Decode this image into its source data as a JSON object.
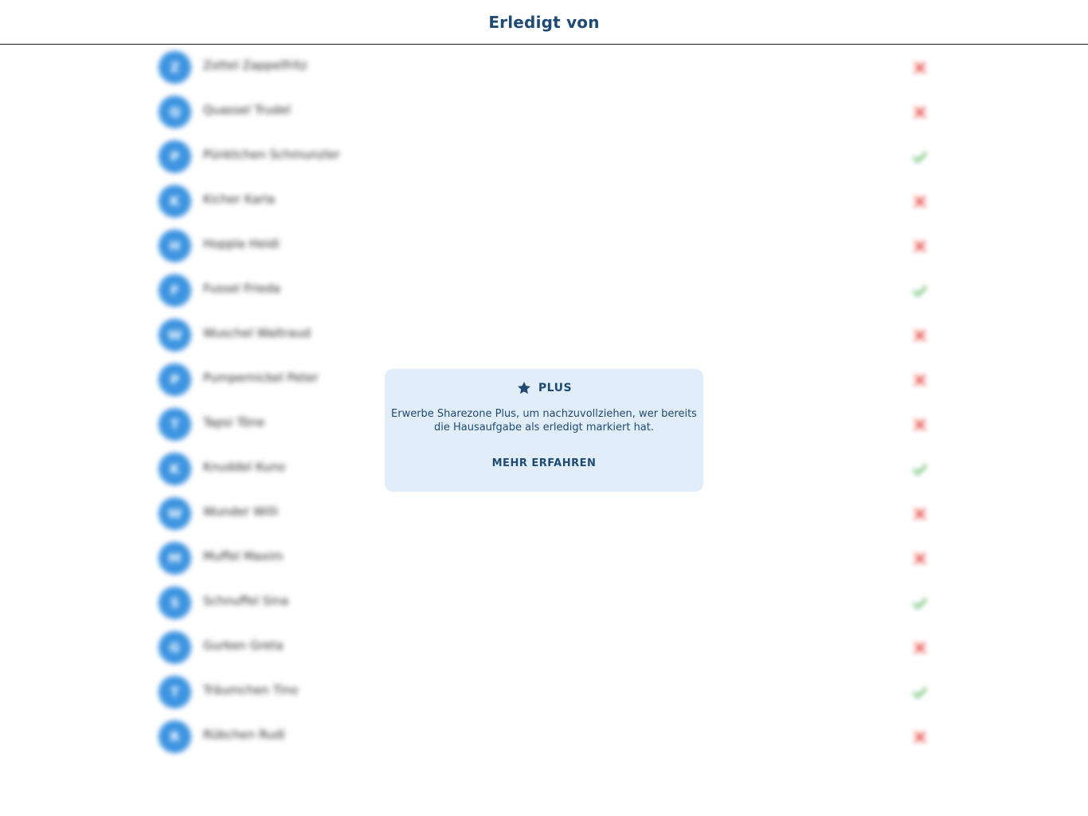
{
  "header": {
    "title": "Erledigt von"
  },
  "colors": {
    "avatar": "#3d94e0",
    "done": "#4caf50",
    "not_done": "#e53935",
    "accent": "#1f4a73",
    "card_bg": "#e1eef9"
  },
  "members": [
    {
      "initial": "Z",
      "name": "Zottel Zappelfritz",
      "done": false
    },
    {
      "initial": "Q",
      "name": "Quassel Trudel",
      "done": false
    },
    {
      "initial": "P",
      "name": "Pünktchen Schmunzler",
      "done": true
    },
    {
      "initial": "K",
      "name": "Kicher Karla",
      "done": false
    },
    {
      "initial": "H",
      "name": "Hoppla Heidi",
      "done": false
    },
    {
      "initial": "F",
      "name": "Fussel Frieda",
      "done": true
    },
    {
      "initial": "W",
      "name": "Wuschel Waltraud",
      "done": false
    },
    {
      "initial": "P",
      "name": "Pumpernickel Peter",
      "done": false
    },
    {
      "initial": "T",
      "name": "Tapsi Töne",
      "done": false
    },
    {
      "initial": "K",
      "name": "Knuddel Kuno",
      "done": true
    },
    {
      "initial": "W",
      "name": "Wunder Willi",
      "done": false
    },
    {
      "initial": "M",
      "name": "Muffel Maxim",
      "done": false
    },
    {
      "initial": "S",
      "name": "Schnuffel Sina",
      "done": true
    },
    {
      "initial": "G",
      "name": "Gurken Greta",
      "done": false
    },
    {
      "initial": "T",
      "name": "Träumchen Tino",
      "done": true
    },
    {
      "initial": "R",
      "name": "Rübchen Rudi",
      "done": false
    }
  ],
  "plus_card": {
    "icon": "star-icon",
    "label": "PLUS",
    "text": "Erwerbe Sharezone Plus, um nachzuvollziehen, wer bereits die Hausaufgabe als erledigt markiert hat.",
    "button_label": "MEHR ERFAHREN"
  }
}
